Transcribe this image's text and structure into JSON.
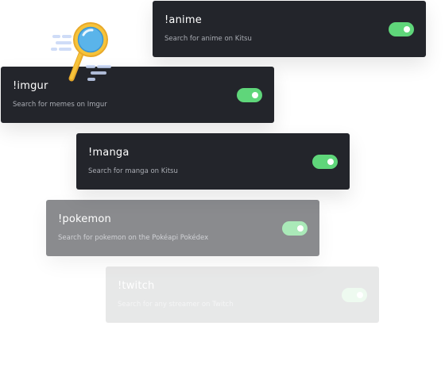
{
  "commands": [
    {
      "title": "!anime",
      "description": "Search for anime on Kitsu",
      "enabled": true
    },
    {
      "title": "!imgur",
      "description": "Search for memes on Imgur",
      "enabled": true
    },
    {
      "title": "!manga",
      "description": "Search for manga on Kitsu",
      "enabled": true
    },
    {
      "title": "!pokemon",
      "description": "Search for pokemon on the Pokéapi Pokédex",
      "enabled": true
    },
    {
      "title": "!twitch",
      "description": "Search for any streamer on Twitch",
      "enabled": true
    }
  ],
  "colors": {
    "card_background": "#23252b",
    "toggle_on": "#5fd67a",
    "title_text": "#ffffff",
    "description_text": "#a9acb3",
    "magnifier_handle": "#f6c33a",
    "magnifier_lens": "#5ab4ea"
  },
  "icons": {
    "search": "magnifying-glass-icon"
  }
}
